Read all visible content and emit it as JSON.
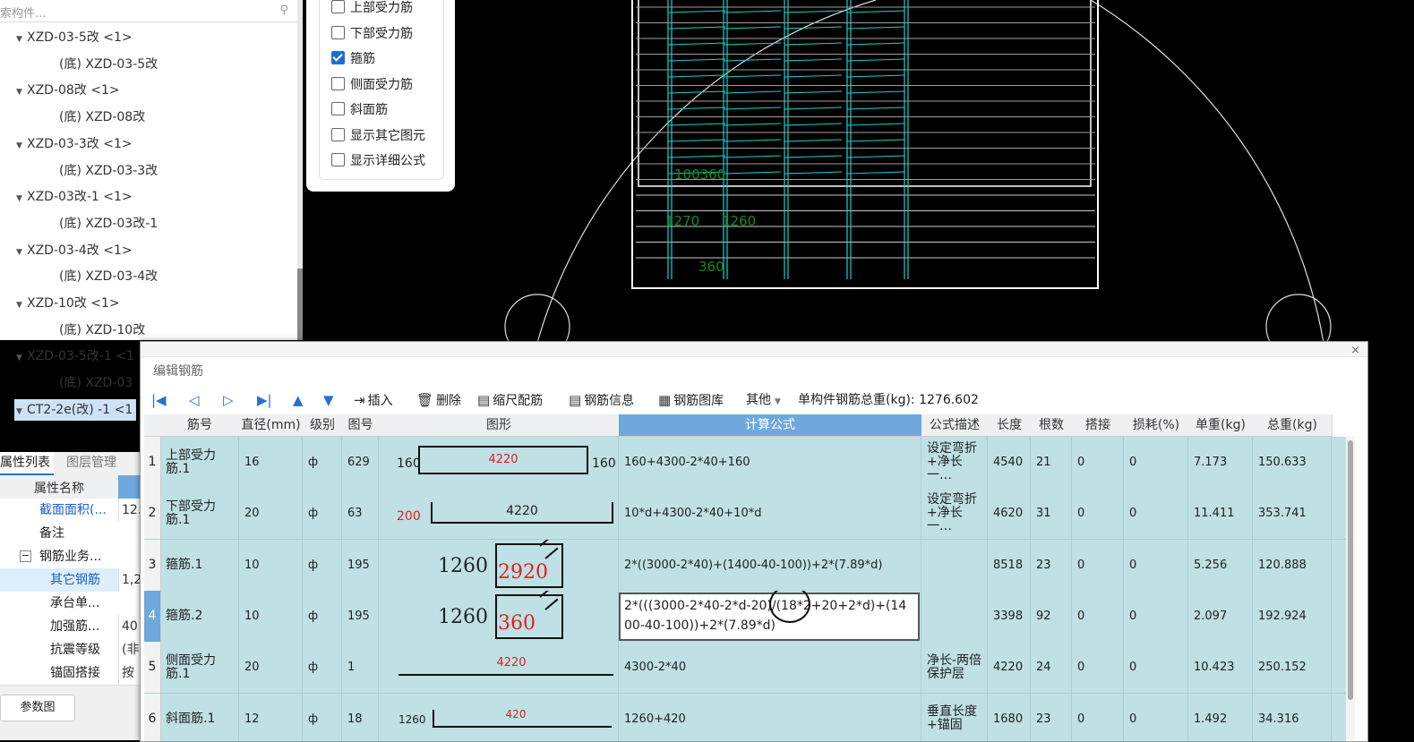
{
  "search": {
    "placeholder": "索构件..."
  },
  "tree": [
    {
      "label": "XZD-03-5改 <1>",
      "level": 0
    },
    {
      "label": "(底) XZD-03-5改",
      "level": 1
    },
    {
      "label": "XZD-08改 <1>",
      "level": 0
    },
    {
      "label": "(底) XZD-08改",
      "level": 1
    },
    {
      "label": "XZD-03-3改 <1>",
      "level": 0
    },
    {
      "label": "(底) XZD-03-3改",
      "level": 1
    },
    {
      "label": "XZD-03改-1 <1>",
      "level": 0
    },
    {
      "label": "(底) XZD-03改-1",
      "level": 1
    },
    {
      "label": "XZD-03-4改 <1>",
      "level": 0
    },
    {
      "label": "(底) XZD-03-4改",
      "level": 1
    },
    {
      "label": "XZD-10改 <1>",
      "level": 0
    },
    {
      "label": "(底) XZD-10改",
      "level": 1
    },
    {
      "label": "XZD-03-5改-1 <1",
      "level": 0
    },
    {
      "label": "(底) XZD-03",
      "level": 1
    },
    {
      "label": "CT2-2e(改) -1 <1",
      "level": 0
    }
  ],
  "checkboxes": [
    {
      "label": "上部受力筋",
      "checked": false
    },
    {
      "label": "下部受力筋",
      "checked": false
    },
    {
      "label": "箍筋",
      "checked": true
    },
    {
      "label": "侧面受力筋",
      "checked": false
    },
    {
      "label": "斜面筋",
      "checked": false
    },
    {
      "label": "显示其它图元",
      "checked": false
    },
    {
      "label": "显示详细公式",
      "checked": false
    }
  ],
  "prop_tabs": {
    "attr_list": "属性列表",
    "layer_mgmt": "图层管理"
  },
  "prop_header": "属性名称",
  "props": [
    {
      "name": "截面面积(...",
      "value": "12.",
      "link": true
    },
    {
      "name": "备注",
      "value": ""
    },
    {
      "name": "钢筋业务...",
      "value": "",
      "expand": "−"
    },
    {
      "name": "其它钢筋",
      "value": "1,2",
      "link": true
    },
    {
      "name": "承台单...",
      "value": ""
    },
    {
      "name": "加强筋...",
      "value": "40"
    },
    {
      "name": "抗震等级",
      "value": "(非"
    },
    {
      "name": "锚固搭接",
      "value": "按"
    }
  ],
  "param_button": "参数图",
  "cad_labels": {
    "a": "100360",
    "b": "1270",
    "c": "1260",
    "d": "360"
  },
  "dialog": {
    "title": "编辑钢筋",
    "close": "×",
    "toolbar": {
      "insert": "插入",
      "delete": "删除",
      "scale": "缩尺配筋",
      "info": "钢筋信息",
      "library": "钢筋图库",
      "other": "其他",
      "total_label": "单构件钢筋总重(kg):",
      "total_value": "1276.602"
    },
    "columns": [
      "筋号",
      "直径(mm)",
      "级别",
      "图号",
      "图形",
      "计算公式",
      "公式描述",
      "长度",
      "根数",
      "搭接",
      "损耗(%)",
      "单重(kg)",
      "总重(kg)"
    ],
    "rows": [
      {
        "no": "1",
        "name": "上部受力筋.1",
        "dia": "16",
        "grade": "ф",
        "fig": "629",
        "shape": {
          "left": "160",
          "mid": "4220",
          "right": "160"
        },
        "formula": "160+4300-2*40+160",
        "desc": "设定弯折+净长一…",
        "len": "4540",
        "count": "21",
        "lap": "0",
        "loss": "0",
        "unit": "7.173",
        "total": "150.633"
      },
      {
        "no": "2",
        "name": "下部受力筋.1",
        "dia": "20",
        "grade": "ф",
        "fig": "63",
        "shape": {
          "left": "200",
          "mid": "4220"
        },
        "formula": "10*d+4300-2*40+10*d",
        "desc": "设定弯折+净长一…",
        "len": "4620",
        "count": "31",
        "lap": "0",
        "loss": "0",
        "unit": "11.411",
        "total": "353.741"
      },
      {
        "no": "3",
        "name": "箍筋.1",
        "dia": "10",
        "grade": "ф",
        "fig": "195",
        "shape": {
          "left": "1260",
          "mid": "2920"
        },
        "formula": "2*((3000-2*40)+(1400-40-100))+2*(7.89*d)",
        "desc": "",
        "len": "8518",
        "count": "23",
        "lap": "0",
        "loss": "0",
        "unit": "5.256",
        "total": "120.888"
      },
      {
        "no": "4",
        "name": "箍筋.2",
        "dia": "10",
        "grade": "ф",
        "fig": "195",
        "shape": {
          "left": "1260",
          "mid": "360"
        },
        "formula": "2*(((3000-2*40-2*d-20)/(18*2+20+2*d)+(1400-40-100))+2*(7.89*d)",
        "desc": "",
        "len": "3398",
        "count": "92",
        "lap": "0",
        "loss": "0",
        "unit": "2.097",
        "total": "192.924"
      },
      {
        "no": "5",
        "name": "侧面受力筋.1",
        "dia": "20",
        "grade": "ф",
        "fig": "1",
        "shape": {
          "mid": "4220"
        },
        "formula": "4300-2*40",
        "desc": "净长-两倍保护层",
        "len": "4220",
        "count": "24",
        "lap": "0",
        "loss": "0",
        "unit": "10.423",
        "total": "250.152"
      },
      {
        "no": "6",
        "name": "斜面筋.1",
        "dia": "12",
        "grade": "ф",
        "fig": "18",
        "shape": {
          "left": "1260",
          "mid": "420"
        },
        "formula": "1260+420",
        "desc": "垂直长度+锚固",
        "len": "1680",
        "count": "23",
        "lap": "0",
        "loss": "0",
        "unit": "1.492",
        "total": "34.316"
      }
    ]
  }
}
